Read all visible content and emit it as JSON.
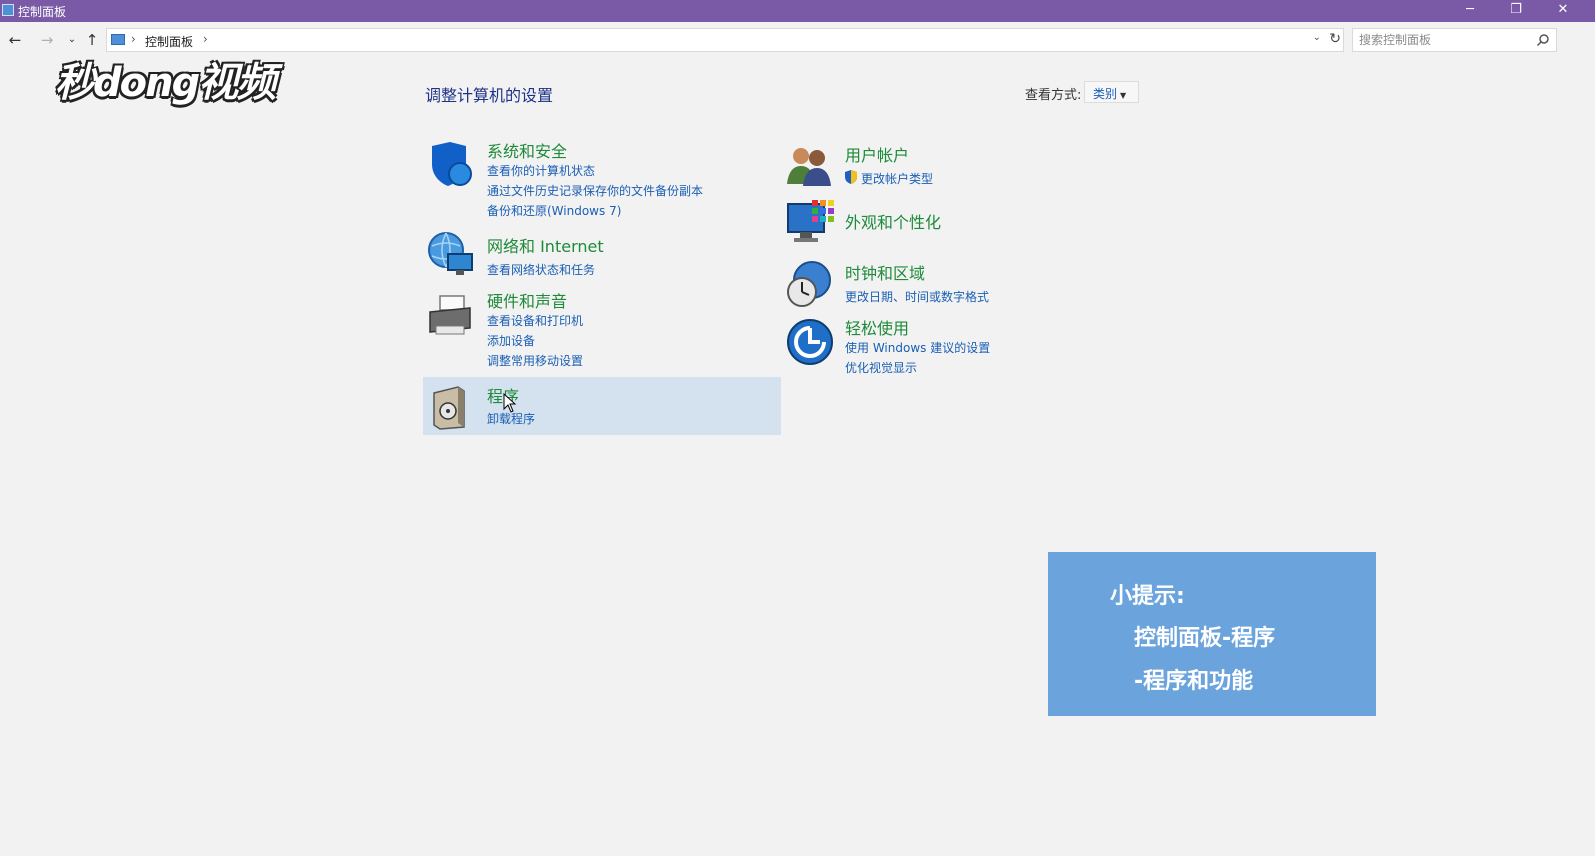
{
  "window": {
    "title": "控制面板",
    "min_glyph": "─",
    "max_glyph": "❐",
    "close_glyph": "✕"
  },
  "nav": {
    "back_glyph": "←",
    "forward_glyph": "→",
    "recent_glyph": "⌄",
    "up_glyph": "↑",
    "breadcrumb": [
      "控制面板"
    ],
    "breadcrumb_sep": "›",
    "dropdown_glyph": "⌄",
    "refresh_glyph": "↻",
    "search_placeholder": "搜索控制面板"
  },
  "logo": {
    "text": "秒dong视频"
  },
  "page": {
    "title": "调整计算机的设置",
    "view_by_label": "查看方式:",
    "view_by_value": "类别"
  },
  "categories_left": [
    {
      "id": "system-security",
      "title": "系统和安全",
      "icon": "shield-icon",
      "links": [
        "查看你的计算机状态",
        "通过文件历史记录保存你的文件备份副本",
        "备份和还原(Windows 7)"
      ]
    },
    {
      "id": "network-internet",
      "title": "网络和 Internet",
      "icon": "network-globe-icon",
      "links": [
        "查看网络状态和任务"
      ]
    },
    {
      "id": "hardware-sound",
      "title": "硬件和声音",
      "icon": "printer-icon",
      "links": [
        "查看设备和打印机",
        "添加设备",
        "调整常用移动设置"
      ]
    },
    {
      "id": "programs",
      "title": "程序",
      "icon": "programs-box-icon",
      "links": [
        "卸载程序"
      ]
    }
  ],
  "categories_right": [
    {
      "id": "user-accounts",
      "title": "用户帐户",
      "icon": "users-icon",
      "links": [
        "更改帐户类型"
      ]
    },
    {
      "id": "appearance",
      "title": "外观和个性化",
      "icon": "monitor-palette-icon",
      "links": []
    },
    {
      "id": "clock-region",
      "title": "时钟和区域",
      "icon": "clock-globe-icon",
      "links": [
        "更改日期、时间或数字格式"
      ]
    },
    {
      "id": "ease-of-access",
      "title": "轻松使用",
      "icon": "ease-access-icon",
      "links": [
        "使用 Windows 建议的设置",
        "优化视觉显示"
      ]
    }
  ],
  "tip": {
    "line1": "小提示:",
    "line2": "控制面板-程序",
    "line3": "-程序和功能"
  },
  "colors": {
    "titlebar": "#7a5aa6",
    "category_title": "#1e8a3a",
    "link": "#1a5fb4",
    "highlight": "#d4e1ee",
    "tip_bg": "#6ba3dc"
  }
}
